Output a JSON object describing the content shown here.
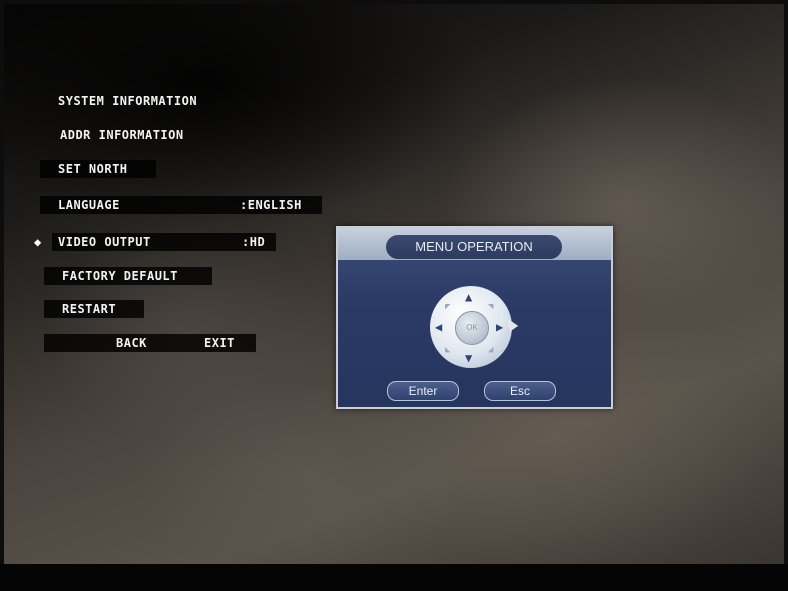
{
  "osd_menu": {
    "items": [
      {
        "label": "SYSTEM INFORMATION"
      },
      {
        "label": "ADDR INFORMATION"
      },
      {
        "label": "SET NORTH"
      },
      {
        "label": "LANGUAGE",
        "value": ":ENGLISH"
      },
      {
        "label": "VIDEO OUTPUT",
        "value": ":HD",
        "selected": true,
        "selector": "◆"
      },
      {
        "label": "FACTORY DEFAULT"
      },
      {
        "label": "RESTART"
      }
    ],
    "back_label": "BACK",
    "exit_label": "EXIT"
  },
  "dialog": {
    "title": "MENU OPERATION",
    "center_label": "OK",
    "enter_label": "Enter",
    "esc_label": "Esc",
    "icons": {
      "up": "▲",
      "down": "▼",
      "left": "◀",
      "right": "▶",
      "up_left": "◤",
      "up_right": "◥",
      "down_left": "◣",
      "down_right": "◢"
    }
  },
  "colors": {
    "dialog_bg": "#2b3b66",
    "dialog_border": "#c7cfdc",
    "menu_text": "#f2f2f2"
  }
}
